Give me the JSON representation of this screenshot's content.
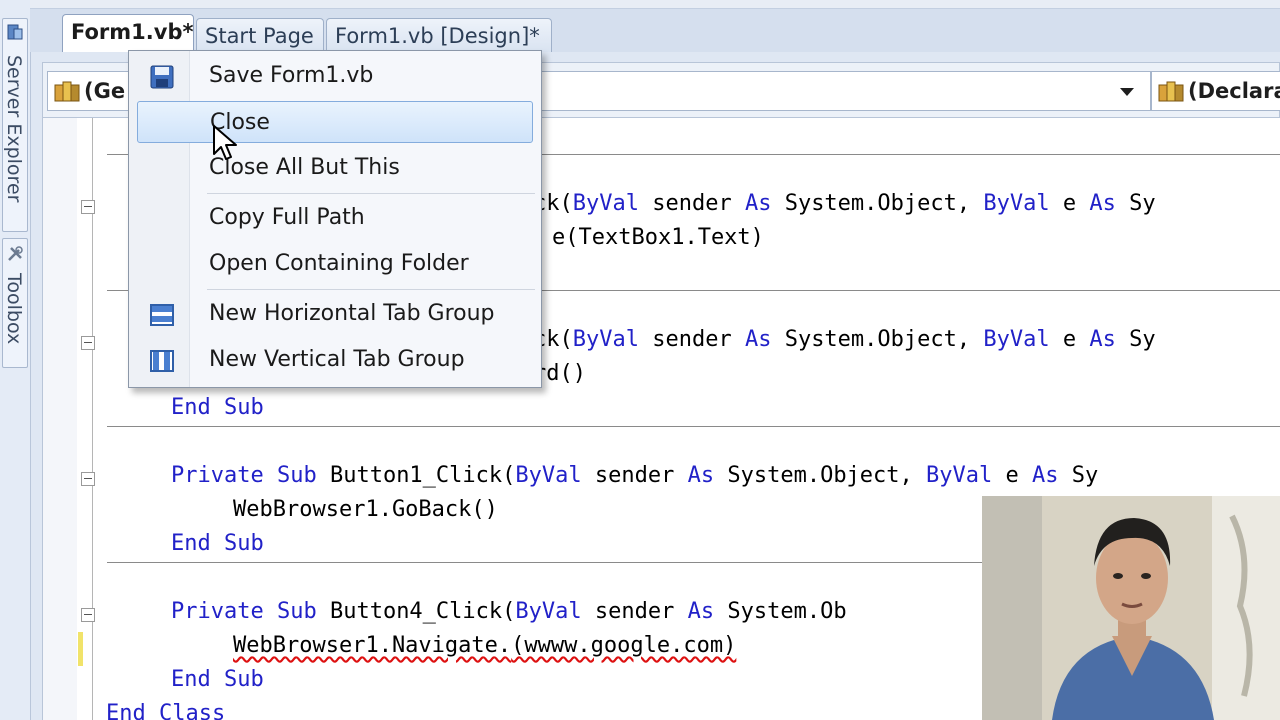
{
  "side_panels": [
    {
      "label": "Server Explorer",
      "icon": "server-explorer-icon"
    },
    {
      "label": "Toolbox",
      "icon": "toolbox-icon"
    }
  ],
  "tabs": [
    {
      "label": "Form1.vb*",
      "active": true
    },
    {
      "label": "Start Page",
      "active": false
    },
    {
      "label": "Form1.vb [Design]*",
      "active": false
    }
  ],
  "nav": {
    "left_combo": "(Ge",
    "right_combo": "(Declara"
  },
  "code_lines": {
    "l1_a": "ck(",
    "l1_b": "ByVal",
    "l1_c": " sender ",
    "l1_d": "As",
    "l1_e": " System.Object, ",
    "l1_f": "ByVal",
    "l1_g": " e ",
    "l1_h": "As",
    "l1_i": " Sy",
    "l2": "e(TextBox1.Text)",
    "l3_a": "ck(",
    "l3_b": "ByVal",
    "l3_c": " sender ",
    "l3_d": "As",
    "l3_e": " System.Object, ",
    "l3_f": "ByVal",
    "l3_g": " e ",
    "l3_h": "As",
    "l3_i": " Sy",
    "l4": "rd()",
    "l5_a": "End",
    "l5_b": "Sub",
    "l6_a": "Private",
    "l6_b": "Sub",
    "l6_c": " Button1_Click(",
    "l6_d": "ByVal",
    "l6_e": " sender ",
    "l6_f": "As",
    "l6_g": " System.Object, ",
    "l6_h": "ByVal",
    "l6_i": " e ",
    "l6_j": "As",
    "l6_k": " Sy",
    "l7": "WebBrowser1.GoBack()",
    "l8_a": "End",
    "l8_b": "Sub",
    "l9_a": "Private",
    "l9_b": "Sub",
    "l9_c": " Button4_Click(",
    "l9_d": "ByVal",
    "l9_e": " sender ",
    "l9_f": "As",
    "l9_g": " System.Ob",
    "l10_a": "WebBrowser1.Navigate.",
    "l10_b": "(wwww.google.com)",
    "l11_a": "End",
    "l11_b": "Sub",
    "l12_a": "End",
    "l12_b": "Class"
  },
  "context_menu": {
    "items": [
      {
        "label": "Save Form1.vb",
        "icon": "save-icon"
      },
      {
        "label": "Close"
      },
      {
        "label": "Close All But This"
      },
      {
        "label": "Copy Full Path"
      },
      {
        "label": "Open Containing Folder"
      },
      {
        "label": "New Horizontal Tab Group",
        "icon": "horizontal-tab-group-icon"
      },
      {
        "label": "New Vertical Tab Group",
        "icon": "vertical-tab-group-icon"
      }
    ],
    "hovered": "Close"
  },
  "colors": {
    "keyword": "#2121c8",
    "menu_hover": "#cfe3fa",
    "modified_marker": "#f1e36a"
  }
}
